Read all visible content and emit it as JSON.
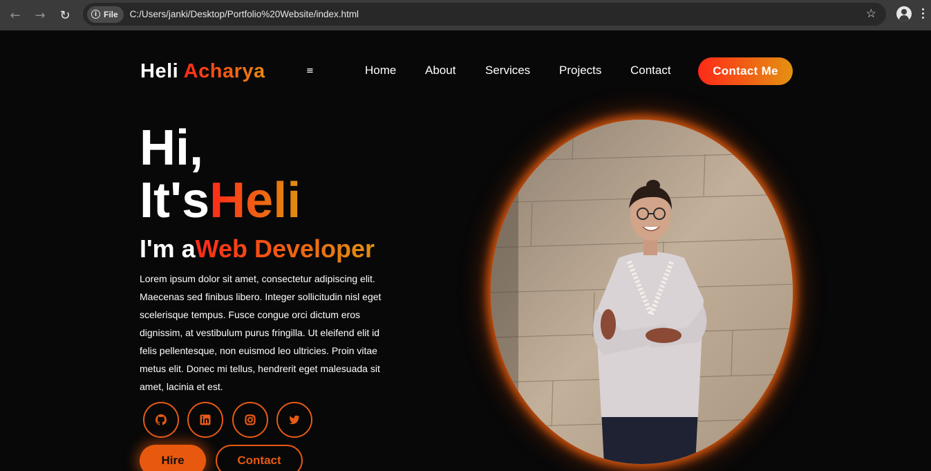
{
  "browser": {
    "scheme_label": "File",
    "url": "C:/Users/janki/Desktop/Portfolio%20Website/index.html"
  },
  "header": {
    "logo_first": "Heli",
    "logo_last": "Acharya",
    "menu_toggle": "≡",
    "nav": [
      "Home",
      "About",
      "Services",
      "Projects",
      "Contact"
    ],
    "cta_label": "Contact Me"
  },
  "hero": {
    "greeting": "Hi,",
    "name_prefix": "It's",
    "name": "Heli",
    "role_prefix": "I'm a",
    "role": "Web Developer",
    "description": "Lorem ipsum dolor sit amet, consectetur adipiscing elit. Maecenas sed finibus libero. Integer sollicitudin nisl eget scelerisque tempus. Fusce congue orci dictum eros dignissim, at vestibulum purus fringilla. Ut eleifend elit id felis pellentesque, non euismod leo ultricies. Proin vitae metus elit. Donec mi tellus, hendrerit eget malesuada sit amet, lacinia et est.",
    "socials": [
      "github-icon",
      "linkedin-icon",
      "instagram-icon",
      "twitter-icon"
    ],
    "hire_label": "Hire",
    "contact_label": "Contact"
  },
  "colors": {
    "accent_start": "#ff2a18",
    "accent_end": "#e0900f",
    "accent_orange": "#e8590f",
    "background": "#080808"
  }
}
